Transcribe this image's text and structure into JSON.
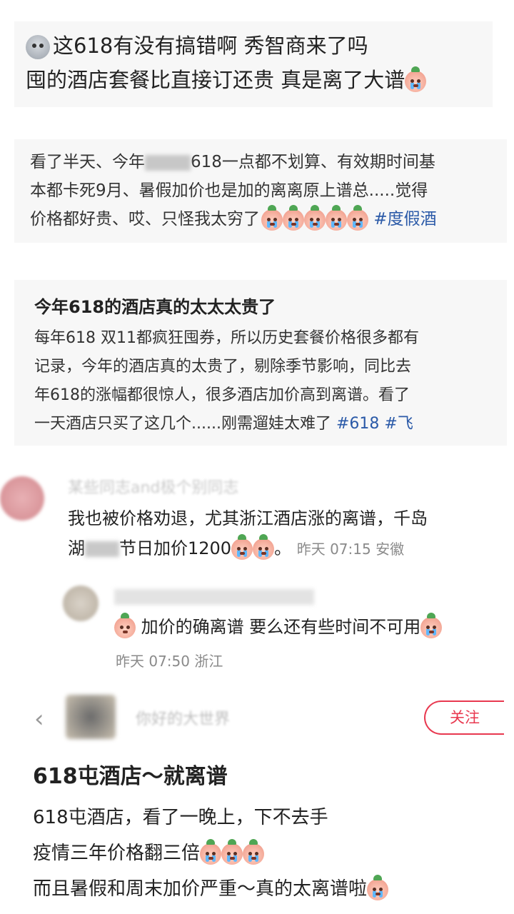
{
  "post1": {
    "line1": "这618有没有搞错啊 秀智商来了吗",
    "line2": "囤的酒店套餐比直接订还贵 真是离了大谱"
  },
  "post2": {
    "line1": "看了半天、今年",
    "line1_tail": "618一点都不划算、有效期时间基",
    "line2": "本都卡死9月、暑假加价也是加的离离原上谱总.....觉得",
    "line3": "价格都好贵、哎、只怪我太穷了",
    "hashtag": "#度假酒"
  },
  "post3": {
    "title": "今年618的酒店真的太太太贵了",
    "line1": "每年618 双11都疯狂囤券，所以历史套餐价格很多都有",
    "line2": "记录，今年的酒店真的太贵了，剔除季节影响，同比去",
    "line3": "年618的涨幅都很惊人，很多酒店加价高到离谱。看了",
    "line4": "一天酒店只买了这几个......刚需遛娃太难了",
    "tag1": "#618",
    "tag2": "#飞"
  },
  "comment1": {
    "username": "某些同志and极个别同志",
    "line1": "我也被价格劝退，尤其浙江酒店涨的离谱，千岛",
    "line2_head": "湖",
    "line2_tail": "节日加价1200",
    "period": "。",
    "time": "昨天 07:15 安徽"
  },
  "reply1": {
    "text": "加价的确离谱  要么还有些时间不可用",
    "time": "昨天 07:50 浙江"
  },
  "post4": {
    "follow_label": "关注",
    "author": "你好的大世界",
    "title": "618屯酒店～就离谱",
    "line1": "618屯酒店，看了一晚上，下不去手",
    "line2": "疫情三年价格翻三倍",
    "line3": "而且暑假和周末加价严重～真的太离谱啦"
  },
  "colors": {
    "hashtag": "#2b5aa8",
    "follow_red": "#e8384f",
    "meta_gray": "#8a8a8a"
  }
}
